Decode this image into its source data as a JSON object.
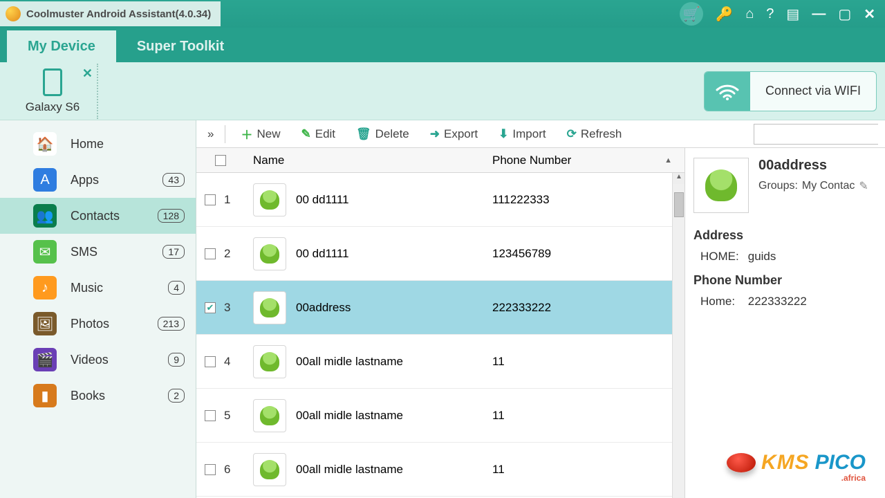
{
  "app": {
    "title": "Coolmuster Android Assistant(4.0.34)"
  },
  "titlebar_icons": [
    "cart",
    "key",
    "home",
    "help",
    "register",
    "minimize",
    "maximize",
    "close"
  ],
  "tabs": {
    "my_device": "My Device",
    "super_toolkit": "Super Toolkit",
    "active": "my_device"
  },
  "device": {
    "name": "Galaxy S6"
  },
  "wifi_button": "Connect via WIFI",
  "sidebar": [
    {
      "id": "home",
      "label": "Home",
      "icon": "home",
      "count": null,
      "expandable": false,
      "active": false
    },
    {
      "id": "apps",
      "label": "Apps",
      "icon": "apps",
      "count": 43,
      "expandable": true,
      "active": false
    },
    {
      "id": "contacts",
      "label": "Contacts",
      "icon": "contacts",
      "count": 128,
      "expandable": false,
      "active": true
    },
    {
      "id": "sms",
      "label": "SMS",
      "icon": "sms",
      "count": 17,
      "expandable": false,
      "active": false
    },
    {
      "id": "music",
      "label": "Music",
      "icon": "music",
      "count": 4,
      "expandable": false,
      "active": false
    },
    {
      "id": "photos",
      "label": "Photos",
      "icon": "photos",
      "count": 213,
      "expandable": true,
      "active": false
    },
    {
      "id": "videos",
      "label": "Videos",
      "icon": "videos",
      "count": 9,
      "expandable": false,
      "active": false
    },
    {
      "id": "books",
      "label": "Books",
      "icon": "books",
      "count": 2,
      "expandable": false,
      "active": false
    }
  ],
  "toolbar": {
    "expand": "»",
    "new": "New",
    "edit": "Edit",
    "delete": "Delete",
    "export": "Export",
    "import": "Import",
    "refresh": "Refresh",
    "search_placeholder": ""
  },
  "icon_colors": {
    "new": "#3fb54a",
    "edit": "#3fb54a",
    "delete": "#2aa591",
    "export": "#2aa591",
    "import": "#2aa591",
    "refresh": "#2aa591"
  },
  "columns": {
    "name": "Name",
    "phone": "Phone Number"
  },
  "contacts": [
    {
      "idx": 1,
      "name": "00 dd1111",
      "phone": "111222333",
      "checked": false,
      "selected": false
    },
    {
      "idx": 2,
      "name": "00 dd1111",
      "phone": "123456789",
      "checked": false,
      "selected": false
    },
    {
      "idx": 3,
      "name": "00address",
      "phone": "222333222",
      "checked": true,
      "selected": true
    },
    {
      "idx": 4,
      "name": "00all midle lastname",
      "phone": "11",
      "checked": false,
      "selected": false
    },
    {
      "idx": 5,
      "name": "00all midle lastname",
      "phone": "11",
      "checked": false,
      "selected": false
    },
    {
      "idx": 6,
      "name": "00all midle lastname",
      "phone": "11",
      "checked": false,
      "selected": false
    }
  ],
  "detail": {
    "name": "00address",
    "groups_label": "Groups:",
    "groups_value": "My Contac",
    "address_header": "Address",
    "address_type": "HOME:",
    "address_value": "guids",
    "phone_header": "Phone Number",
    "phone_type": "Home:",
    "phone_value": "222333222"
  },
  "watermark": {
    "brand1": "KMS",
    "brand2": "PICO",
    "sub": ".africa"
  }
}
